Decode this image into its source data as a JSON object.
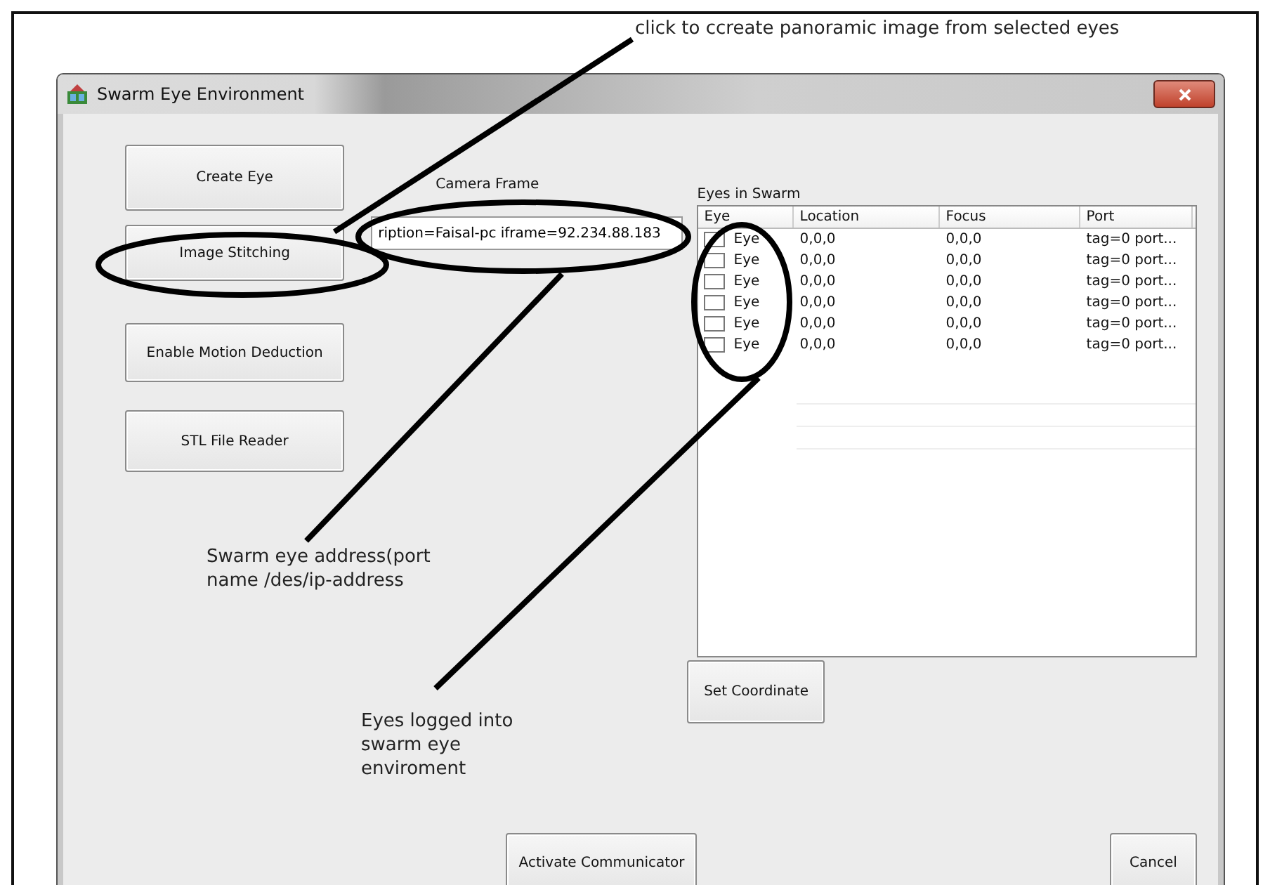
{
  "window": {
    "title": "Swarm Eye Environment"
  },
  "left_buttons": [
    {
      "label": "Create  Eye"
    },
    {
      "label": "Image Stitching"
    },
    {
      "label": "Enable Motion Deduction"
    },
    {
      "label": "STL File Reader"
    }
  ],
  "camera_frame": {
    "label": "Camera Frame",
    "value": "ription=Faisal-pc iframe=92.234.88.183"
  },
  "eyes_list": {
    "label": "Eyes in Swarm",
    "columns": [
      "Eye",
      "Location",
      "Focus",
      "Port"
    ],
    "rows": [
      {
        "checked": false,
        "eye": "Eye",
        "location": "0,0,0",
        "focus": "0,0,0",
        "port": "tag=0 port..."
      },
      {
        "checked": false,
        "eye": "Eye",
        "location": "0,0,0",
        "focus": "0,0,0",
        "port": "tag=0 port..."
      },
      {
        "checked": false,
        "eye": "Eye",
        "location": "0,0,0",
        "focus": "0,0,0",
        "port": "tag=0 port..."
      },
      {
        "checked": false,
        "eye": "Eye",
        "location": "0,0,0",
        "focus": "0,0,0",
        "port": "tag=0 port..."
      },
      {
        "checked": false,
        "eye": "Eye",
        "location": "0,0,0",
        "focus": "0,0,0",
        "port": "tag=0 port..."
      },
      {
        "checked": false,
        "eye": "Eye",
        "location": "0,0,0",
        "focus": "0,0,0",
        "port": "tag=0 port..."
      }
    ]
  },
  "set_coordinate_button": "Set Coordinate",
  "activate_button": "Activate Communicator",
  "cancel_button": "Cancel",
  "annotations": [
    {
      "text": "click to ccreate panoramic image from selected eyes"
    },
    {
      "text": "Swarm eye address(port name /des/ip-address"
    },
    {
      "text": "Eyes logged into swarm eye enviroment"
    }
  ]
}
